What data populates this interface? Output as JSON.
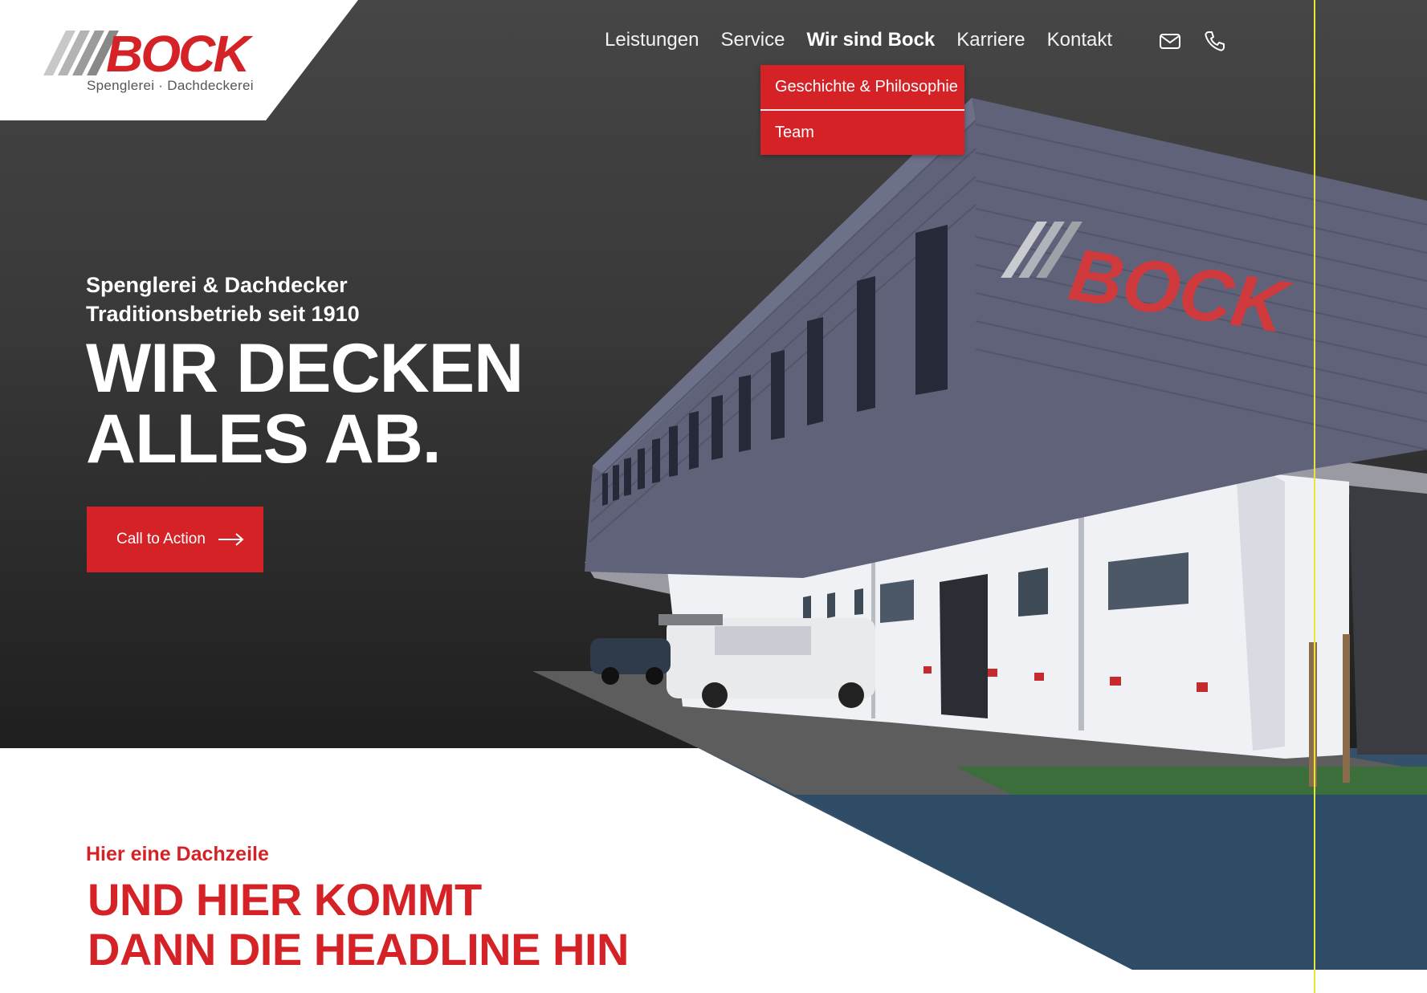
{
  "brand": {
    "logo_text": "BOCK",
    "tagline": "Spenglerei · Dachdeckerei",
    "accent_color": "#d42226"
  },
  "nav": {
    "items": [
      {
        "label": "Leistungen"
      },
      {
        "label": "Service"
      },
      {
        "label": "Wir sind Bock",
        "active": true
      },
      {
        "label": "Karriere"
      },
      {
        "label": "Kontakt"
      }
    ],
    "icons": [
      "mail-icon",
      "phone-icon"
    ],
    "dropdown": [
      {
        "label": "Geschichte & Philosophie"
      },
      {
        "label": "Team"
      }
    ]
  },
  "hero": {
    "kicker_line1": "Spenglerei & Dachdecker",
    "kicker_line2": "Traditionsbetrieb seit 1910",
    "headline_line1": "WIR DECKEN",
    "headline_line2": "ALLES AB.",
    "cta_label": "Call to Action",
    "building_sign": "BOCK"
  },
  "section": {
    "dachzeile": "Hier eine Dachzeile",
    "headline_line1": "UND HIER KOMMT",
    "headline_line2": "DANN DIE HEADLINE HIN"
  }
}
